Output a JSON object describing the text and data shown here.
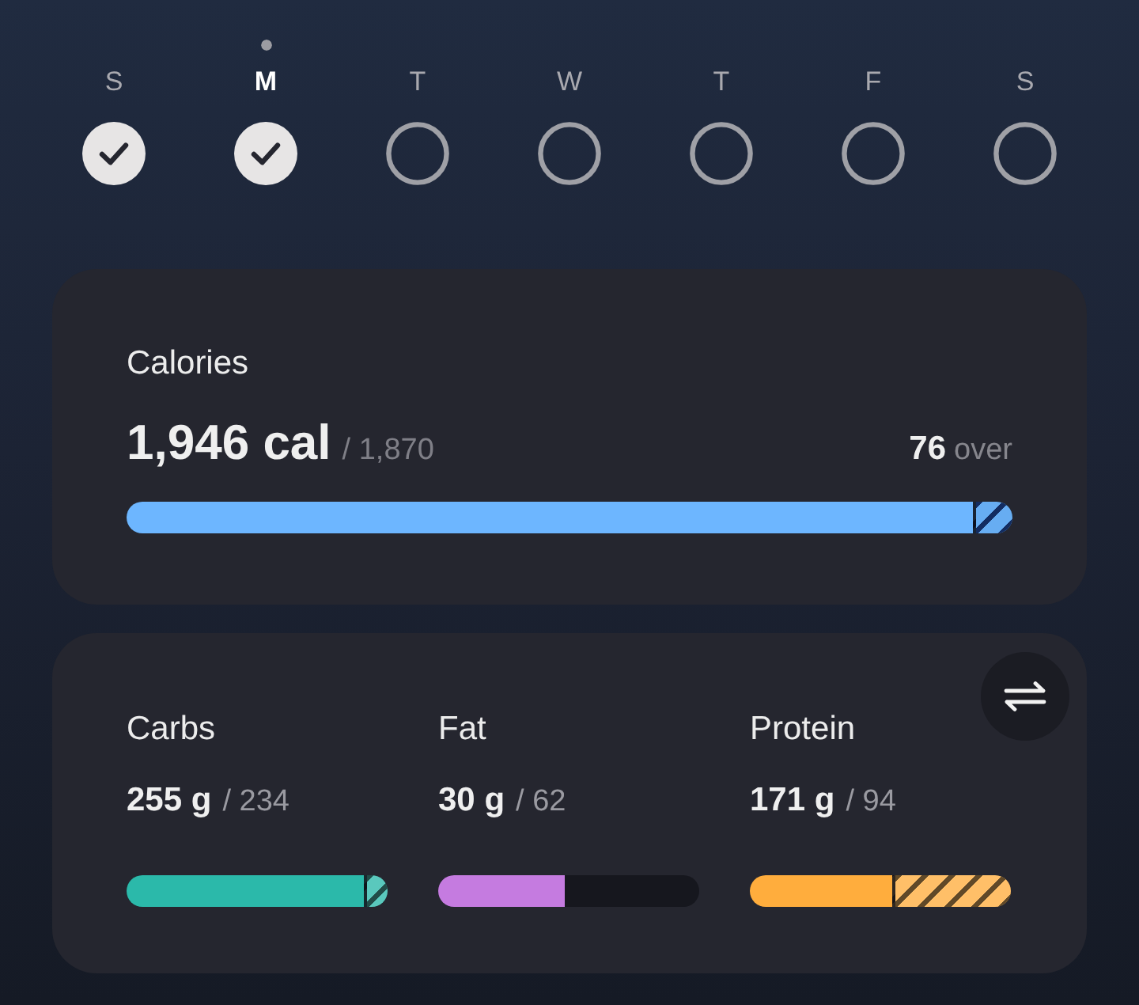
{
  "days": [
    {
      "label": "S",
      "selected": false,
      "checked": true
    },
    {
      "label": "M",
      "selected": true,
      "checked": true
    },
    {
      "label": "T",
      "selected": false,
      "checked": false
    },
    {
      "label": "W",
      "selected": false,
      "checked": false
    },
    {
      "label": "T",
      "selected": false,
      "checked": false
    },
    {
      "label": "F",
      "selected": false,
      "checked": false
    },
    {
      "label": "S",
      "selected": false,
      "checked": false
    }
  ],
  "calories": {
    "title": "Calories",
    "value": "1,946 cal",
    "goal": "/ 1,870",
    "over_amount": "76",
    "over_label": "over",
    "bar": [
      {
        "kind": "solid",
        "level": 0.955
      },
      {
        "kind": "striped",
        "level": 0.045
      }
    ]
  },
  "macros": [
    {
      "name": "Carbs",
      "value": "255 g",
      "goal": "/ 234",
      "color": "#2bb9aa",
      "bar": [
        {
          "kind": "solid",
          "level": 0.91
        },
        {
          "kind": "striped",
          "level": 0.09
        }
      ]
    },
    {
      "name": "Fat",
      "value": "30 g",
      "goal": "/ 62",
      "color": "#c57be0",
      "bar": [
        {
          "kind": "solid",
          "level": 0.485
        }
      ]
    },
    {
      "name": "Protein",
      "value": "171 g",
      "goal": "/ 94",
      "color": "#ffad3d",
      "bar": [
        {
          "kind": "solid",
          "level": 0.545
        },
        {
          "kind": "striped",
          "level": 0.455
        }
      ]
    }
  ]
}
